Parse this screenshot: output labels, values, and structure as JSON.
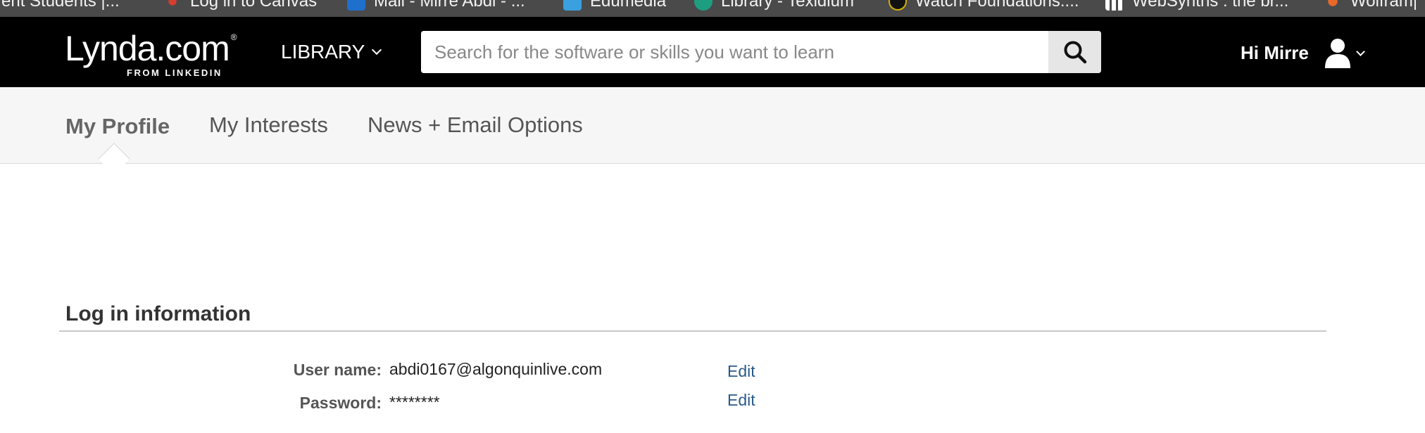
{
  "bookmarks": [
    {
      "label": "rent Students |...",
      "icon": "red-orbit",
      "color": "#4a4a4a"
    },
    {
      "label": "Log in to Canvas",
      "icon": "canvas-icon",
      "color": "#d63c2f"
    },
    {
      "label": "Mail - Mirre Abdi - ...",
      "icon": "outlook-icon",
      "color": "#1f6fcc"
    },
    {
      "label": "Edumedia",
      "icon": "edumedia-icon",
      "color": "#3aa0e0"
    },
    {
      "label": "Library - Texidium",
      "icon": "texidium-icon",
      "color": "#1e9e80"
    },
    {
      "label": "Watch Foundations:...",
      "icon": "lynda-icon",
      "color": "#2b2b2b"
    },
    {
      "label": "WebSynths : the br...",
      "icon": "websynths-icon",
      "color": "#ffffff"
    },
    {
      "label": "Wolfram|",
      "icon": "wolfram-icon",
      "color": "#e8682a"
    }
  ],
  "header": {
    "logo_main": "Lynda.com",
    "logo_reg": "®",
    "logo_sub": "FROM LINKEDIN",
    "library_label": "LIBRARY",
    "search_placeholder": "Search for the software or skills you want to learn",
    "greeting": "Hi Mirre"
  },
  "tabs": [
    {
      "label": "My Profile",
      "active": true
    },
    {
      "label": "My Interests",
      "active": false
    },
    {
      "label": "News + Email Options",
      "active": false
    }
  ],
  "login_section": {
    "title": "Log in information",
    "username_label": "User name:",
    "username_value": "abdi0167@algonquinlive.com",
    "password_label": "Password:",
    "password_value": "********",
    "edit_label": "Edit"
  }
}
